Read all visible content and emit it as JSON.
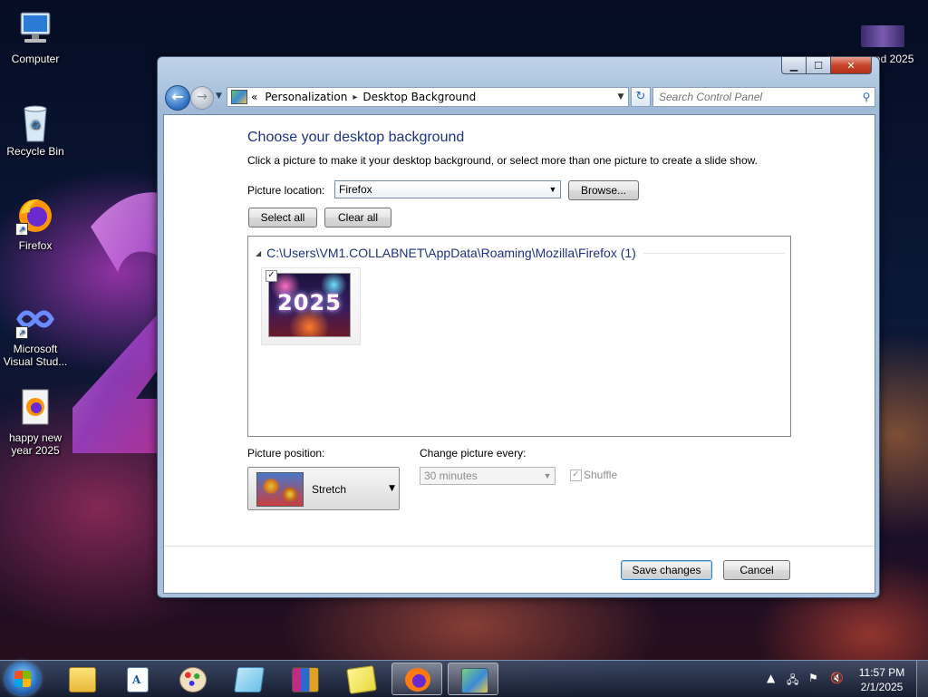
{
  "desktop": {
    "icons": [
      {
        "label": "Computer"
      },
      {
        "label": "Recycle Bin"
      },
      {
        "label": "Firefox"
      },
      {
        "label": "Microsoft Visual Stud..."
      },
      {
        "label": "happy new year 2025"
      }
    ],
    "top_right_label": "ed 2025"
  },
  "window": {
    "breadcrumb": {
      "chevrons": "«",
      "items": [
        "Personalization",
        "Desktop Background"
      ],
      "separator": "▸"
    },
    "search_placeholder": "Search Control Panel",
    "heading": "Choose your desktop background",
    "description": "Click a picture to make it your desktop background, or select more than one picture to create a slide show.",
    "picture_location": {
      "label": "Picture location:",
      "value": "Firefox",
      "browse_label": "Browse..."
    },
    "select_all_label": "Select all",
    "clear_all_label": "Clear all",
    "gallery": {
      "group_title": "C:\\Users\\VM1.COLLABNET\\AppData\\Roaming\\Mozilla\\Firefox (1)",
      "items": [
        {
          "thumb_text": "2025",
          "checked": true
        }
      ]
    },
    "picture_position": {
      "label": "Picture position:",
      "value": "Stretch"
    },
    "change_picture": {
      "label": "Change picture every:",
      "value": "30 minutes",
      "enabled": false
    },
    "shuffle": {
      "label": "Shuffle",
      "checked": true,
      "enabled": false
    },
    "save_label": "Save changes",
    "cancel_label": "Cancel"
  },
  "taskbar": {
    "apps": [
      "windows-explorer",
      "wordpad",
      "paint",
      "notepad",
      "winrar",
      "sticky-notes",
      "firefox",
      "control-panel"
    ],
    "active_app": "control-panel",
    "clock": {
      "time": "11:57 PM",
      "date": "2/1/2025"
    }
  },
  "colors": {
    "heading": "#1e3287",
    "taskbar": "#1e2d48",
    "close_button": "#c8452c"
  }
}
